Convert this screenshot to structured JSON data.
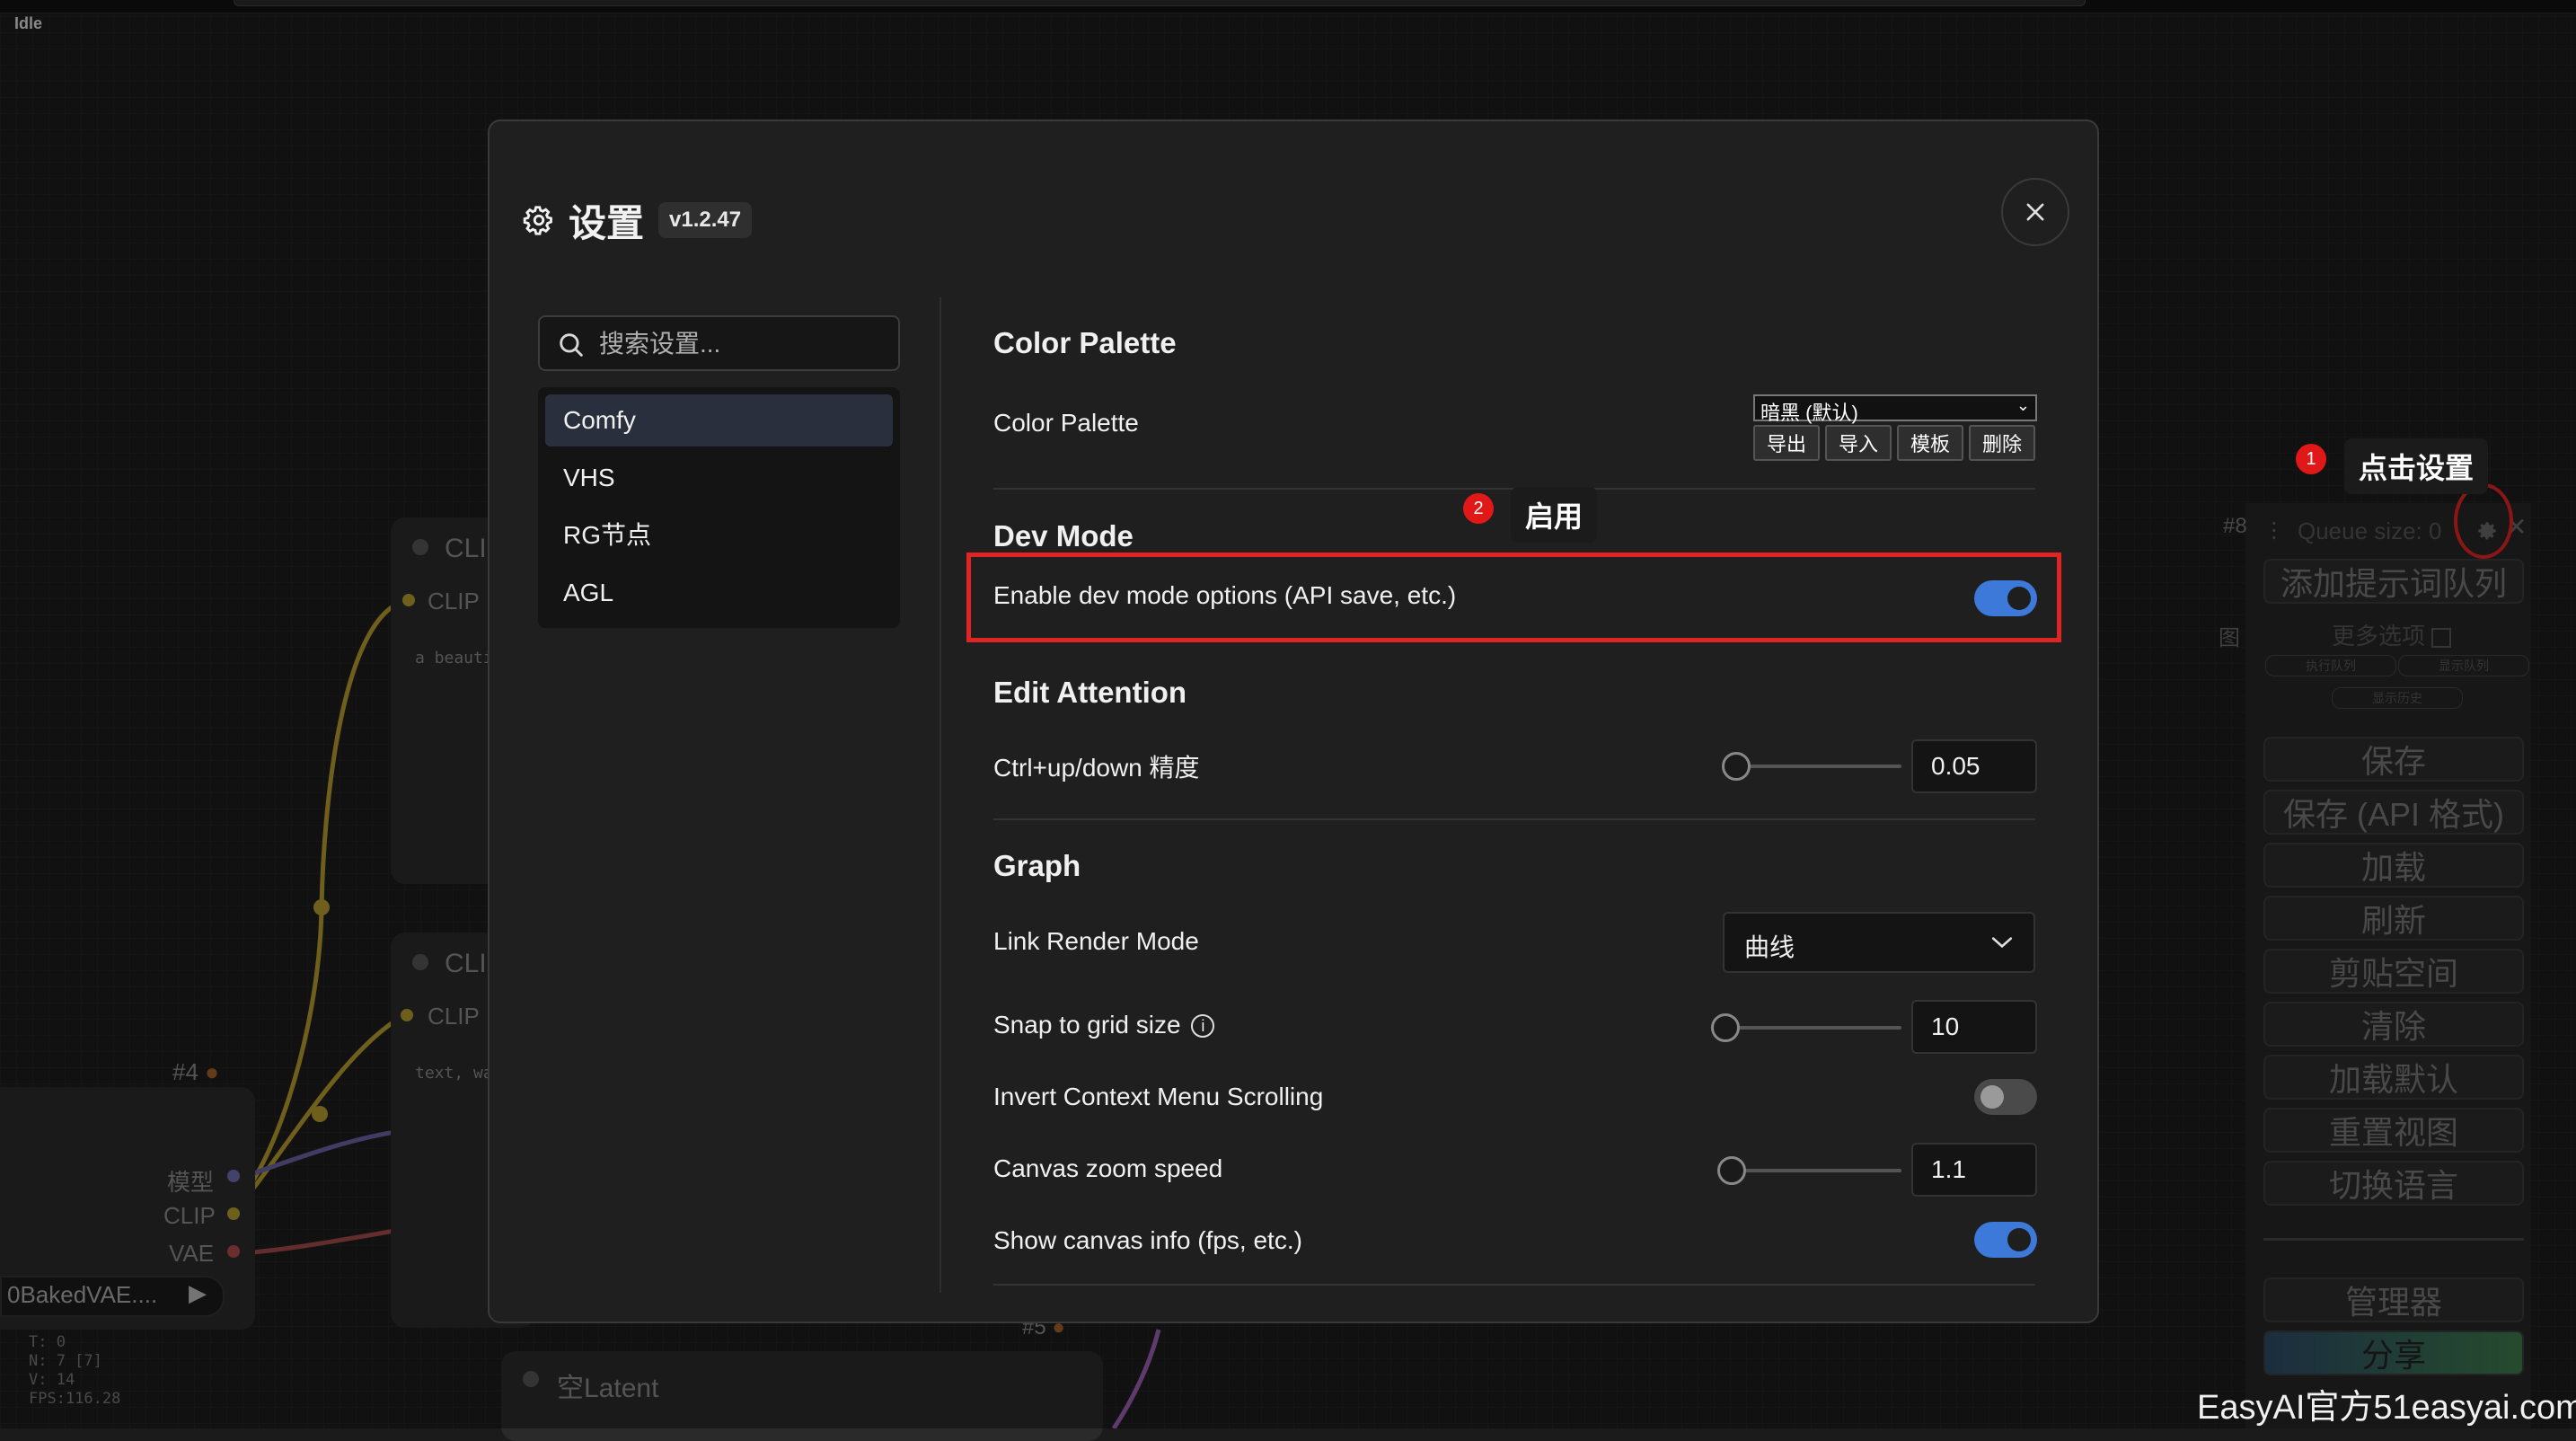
{
  "app": {
    "status": "Idle"
  },
  "dialog": {
    "title": "设置",
    "version": "v1.2.47",
    "search_placeholder": "搜索设置...",
    "categories": [
      "Comfy",
      "VHS",
      "RG节点",
      "AGL"
    ],
    "active_category": "Comfy"
  },
  "settings": {
    "color_palette": {
      "section": "Color Palette",
      "label": "Color Palette",
      "selected": "暗黑 (默认)",
      "buttons": [
        "导出",
        "导入",
        "模板",
        "删除"
      ]
    },
    "dev_mode": {
      "section": "Dev Mode",
      "label": "Enable dev mode options (API save, etc.)",
      "enabled": true
    },
    "edit_attention": {
      "section": "Edit Attention",
      "label": "Ctrl+up/down 精度",
      "value": "0.05"
    },
    "graph": {
      "section": "Graph",
      "link_render_mode": {
        "label": "Link Render Mode",
        "value": "曲线"
      },
      "snap_to_grid": {
        "label": "Snap to grid size",
        "value": "10"
      },
      "invert_context_menu": {
        "label": "Invert Context Menu Scrolling",
        "enabled": false
      },
      "canvas_zoom_speed": {
        "label": "Canvas zoom speed",
        "value": "1.1"
      },
      "show_canvas_info": {
        "label": "Show canvas info (fps, etc.)",
        "enabled": true
      }
    }
  },
  "annotations": {
    "badge1": "1",
    "tip1": "点击设置",
    "badge2": "2",
    "tip2": "启用"
  },
  "queue_panel": {
    "node_id": "#8",
    "queue_size": "Queue size: 0",
    "add_prompt": "添加提示词队列",
    "more_options": "更多选项",
    "small_buttons": [
      "执行队列",
      "显示队列",
      "显示历史"
    ],
    "buttons": [
      "保存",
      "保存 (API 格式)",
      "加载",
      "刷新",
      "剪贴空间",
      "清除",
      "加载默认",
      "重置视图",
      "切换语言"
    ],
    "manager": "管理器",
    "share": "分享",
    "side_char": "图"
  },
  "canvas": {
    "node_titles": [
      "CLI",
      "CLI",
      "空Latent"
    ],
    "clip_label": "CLIP",
    "node4_id": "#4",
    "node5_id": "#5",
    "outputs": [
      "模型",
      "CLIP",
      "VAE"
    ],
    "ckpt_name": "0BakedVAE....",
    "text1": "a beauti",
    "text2": "text, wa",
    "stats": [
      "T: 0",
      "N: 7 [7]",
      "V: 14",
      "FPS:116.28"
    ]
  },
  "watermark": "EasyAI官方51easyai.com",
  "colors": {
    "accent": "#3d79d8",
    "highlight": "#e02424",
    "badge": "#e01818"
  }
}
